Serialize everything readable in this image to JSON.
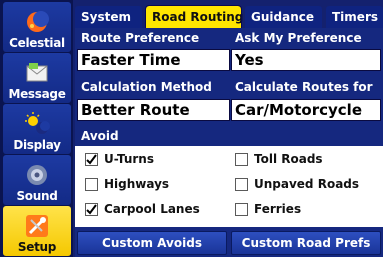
{
  "sidebar": {
    "items": [
      {
        "label": "Celestial",
        "icon": "celestial-moon-icon",
        "selected": false
      },
      {
        "label": "Message",
        "icon": "message-envelope-icon",
        "selected": false
      },
      {
        "label": "Display",
        "icon": "display-sun-moon-icon",
        "selected": false
      },
      {
        "label": "Sound",
        "icon": "sound-speaker-icon",
        "selected": false
      },
      {
        "label": "Setup",
        "icon": "setup-tools-icon",
        "selected": true
      }
    ]
  },
  "tabs": [
    {
      "label": "System",
      "active": false
    },
    {
      "label": "Road Routing",
      "active": true
    },
    {
      "label": "Guidance",
      "active": false
    },
    {
      "label": "Timers",
      "active": false
    }
  ],
  "fields": {
    "route_preference": {
      "label": "Route Preference",
      "value": "Faster Time"
    },
    "ask_my_preference": {
      "label": "Ask My Preference",
      "value": "Yes"
    },
    "calculation_method": {
      "label": "Calculation Method",
      "value": "Better Route"
    },
    "calculate_routes_for": {
      "label": "Calculate Routes for",
      "value": "Car/Motorcycle"
    }
  },
  "avoid": {
    "label": "Avoid",
    "options": [
      {
        "label": "U-Turns",
        "checked": true
      },
      {
        "label": "Highways",
        "checked": false
      },
      {
        "label": "Carpool Lanes",
        "checked": true
      },
      {
        "label": "Toll Roads",
        "checked": false
      },
      {
        "label": "Unpaved Roads",
        "checked": false
      },
      {
        "label": "Ferries",
        "checked": false
      }
    ]
  },
  "buttons": {
    "custom_avoids": "Custom Avoids",
    "custom_road_prefs": "Custom Road Prefs"
  },
  "colors": {
    "background": "#14216e",
    "accent_yellow": "#ffe600",
    "panel": "#15287f"
  }
}
